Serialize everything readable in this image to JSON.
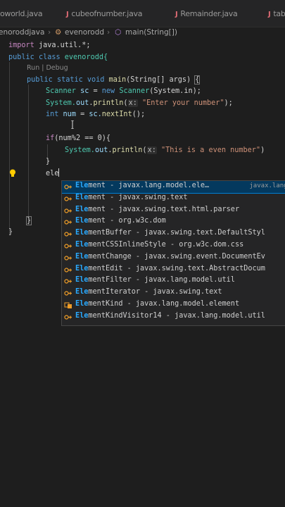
{
  "tabs": [
    {
      "label": "oworld.java",
      "icon": false
    },
    {
      "label": "cubeofnumber.java",
      "icon": true
    },
    {
      "label": "Remainder.java",
      "icon": true
    },
    {
      "label": "tab",
      "icon": true
    }
  ],
  "breadcrumb": {
    "file": "enoroddjava",
    "class": "evenorodd",
    "method": "main(String[])"
  },
  "codelens": "Run | Debug",
  "code": {
    "l1": {
      "kw": "import",
      "rest": " java.util.*;"
    },
    "l2": {
      "kw1": "public",
      "kw2": "class",
      "name": "evenorodd{"
    },
    "l3": {
      "kw1": "public",
      "kw2": "static",
      "kw3": "void",
      "fn": "main",
      "args": "(String[] args)",
      "brace": "{"
    },
    "l4": {
      "type": "Scanner",
      "var": "sc",
      "eq": " = ",
      "new": "new",
      "ctor": "Scanner",
      "arg": "(System.in);"
    },
    "l5": {
      "obj": "System.",
      "out": "out",
      "dot": ".",
      "fn": "println",
      "hint": "x:",
      "str": "\"Enter your number\"",
      "end": ");"
    },
    "l6": {
      "kw": "int",
      "var": "num",
      "eq": " = ",
      "obj": "sc.",
      "fn": "nextInt",
      "end": "();"
    },
    "l7": {
      "kw": "if",
      "cond": "(num%2 == 0){"
    },
    "l8": {
      "obj": "System.",
      "out": "out",
      "dot": ".",
      "fn": "println",
      "hint": "x:",
      "str": "\"This is a even number\"",
      "end": ")"
    },
    "l9": {
      "brace": "}"
    },
    "l10": {
      "typed": "ele"
    },
    "l11": {
      "brace": "}"
    },
    "l12": {
      "brace": "}"
    }
  },
  "suggestions": [
    {
      "icon": "class",
      "match": "Ele",
      "rest": "ment - javax.lang.model.ele…",
      "detail": "javax.lang.",
      "selected": true
    },
    {
      "icon": "class",
      "match": "Ele",
      "rest": "ment - javax.swing.text",
      "detail": "",
      "selected": false
    },
    {
      "icon": "class",
      "match": "Ele",
      "rest": "ment - javax.swing.text.html.parser",
      "detail": "",
      "selected": false
    },
    {
      "icon": "class",
      "match": "Ele",
      "rest": "ment - org.w3c.dom",
      "detail": "",
      "selected": false
    },
    {
      "icon": "class",
      "match": "Ele",
      "rest": "mentBuffer - javax.swing.text.DefaultStyl",
      "detail": "",
      "selected": false
    },
    {
      "icon": "class",
      "match": "Ele",
      "rest": "mentCSSInlineStyle - org.w3c.dom.css",
      "detail": "",
      "selected": false
    },
    {
      "icon": "class",
      "match": "Ele",
      "rest": "mentChange - javax.swing.event.DocumentEv",
      "detail": "",
      "selected": false
    },
    {
      "icon": "class",
      "match": "Ele",
      "rest": "mentEdit - javax.swing.text.AbstractDocum",
      "detail": "",
      "selected": false
    },
    {
      "icon": "class",
      "match": "Ele",
      "rest": "mentFilter - javax.lang.model.util",
      "detail": "",
      "selected": false
    },
    {
      "icon": "class",
      "match": "Ele",
      "rest": "mentIterator - javax.swing.text",
      "detail": "",
      "selected": false
    },
    {
      "icon": "enum",
      "match": "Ele",
      "rest": "mentKind - javax.lang.model.element",
      "detail": "",
      "selected": false
    },
    {
      "icon": "class",
      "match": "Ele",
      "rest": "mentKindVisitor14 - javax.lang.model.util",
      "detail": "",
      "selected": false
    }
  ],
  "colors": {
    "editor_bg": "#1e1e1e",
    "keyword": "#569cd6",
    "control_keyword": "#c586c0",
    "type": "#4ec9b0",
    "function": "#dcdcaa",
    "string": "#ce9178",
    "match_highlight": "#2aaaff",
    "selection": "#04395e"
  }
}
